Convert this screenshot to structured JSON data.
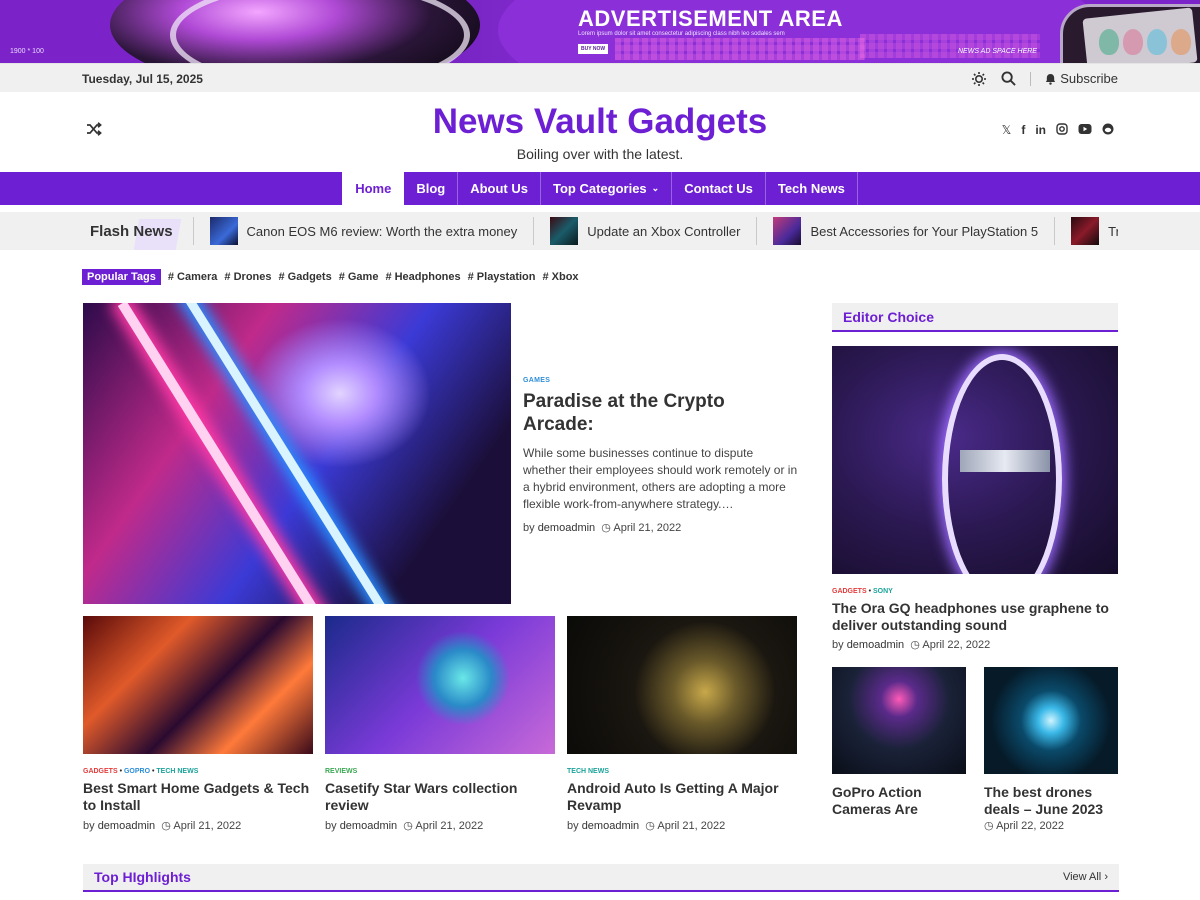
{
  "ad": {
    "size_label": "1900 * 100",
    "title": "ADVERTISEMENT AREA",
    "subtitle": "Lorem ipsum dolor sit amet consectetur adipiscing class nibh leo sodales sem",
    "buy_label": "BUY NOW",
    "space_label": "NEWS AD SPACE HERE"
  },
  "topbar": {
    "date": "Tuesday, Jul 15, 2025",
    "subscribe": "Subscribe"
  },
  "header": {
    "title": "News Vault Gadgets",
    "tagline": "Boiling over with the latest."
  },
  "nav": {
    "items": [
      "Home",
      "Blog",
      "About Us",
      "Top Categories",
      "Contact Us",
      "Tech News"
    ]
  },
  "flash": {
    "label_a": "Flash",
    "label_b": "News",
    "items": [
      "Canon EOS M6 review: Worth the extra money",
      "Update an Xbox Controller",
      "Best Accessories for Your PlayStation 5",
      "Tro"
    ]
  },
  "tags": {
    "label": "Popular Tags",
    "items": [
      "# Camera",
      "# Drones",
      "# Gadgets",
      "# Game",
      "# Headphones",
      "# Playstation",
      "# Xbox"
    ]
  },
  "hero": {
    "category": "GAMES",
    "title": "Paradise at the Crypto Arcade:",
    "excerpt": "While some businesses continue to dispute whether their employees should work remotely or in a hybrid environment, others are adopting a more flexible work-from-anywhere strategy.…",
    "author": "demoadmin",
    "date": "April 21, 2022"
  },
  "cards": [
    {
      "cats": [
        "GADGETS",
        "GOPRO",
        "TECH NEWS"
      ],
      "title": "Best Smart Home Gadgets & Tech to Install",
      "author": "demoadmin",
      "date": "April 21, 2022"
    },
    {
      "cats": [
        "REVIEWS"
      ],
      "title": "Casetify Star Wars collection review",
      "author": "demoadmin",
      "date": "April 21, 2022"
    },
    {
      "cats": [
        "TECH NEWS"
      ],
      "title": "Android Auto Is Getting A Major Revamp",
      "author": "demoadmin",
      "date": "April 21, 2022"
    }
  ],
  "sidebar": {
    "heading": "Editor Choice",
    "featured": {
      "cats": [
        "GADGETS",
        "SONY"
      ],
      "title": "The Ora GQ headphones use graphene to deliver outstanding sound",
      "author": "demoadmin",
      "date": "April 22, 2022"
    },
    "small": [
      {
        "title": "GoPro Action Cameras Are"
      },
      {
        "title": "The best drones deals – June 2023",
        "date": "April 22, 2022"
      }
    ]
  },
  "highlights": {
    "heading": "Top HIghlights",
    "view_all": "View All"
  },
  "common": {
    "by": "by"
  }
}
